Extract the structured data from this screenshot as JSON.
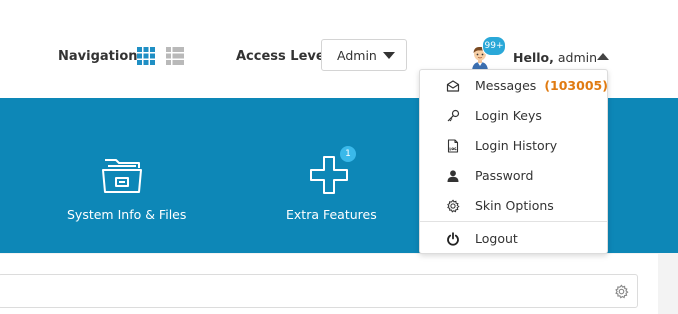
{
  "header": {
    "navigation_label": "Navigation",
    "access_level_label": "Access Level",
    "access_level_value": "Admin",
    "avatar_badge": "99+",
    "greeting": "Hello,",
    "username": "admin"
  },
  "tiles": [
    {
      "label": "System Info & Files",
      "icon": "folder-icon"
    },
    {
      "label": "Extra Features",
      "icon": "plus-icon",
      "badge": "1"
    }
  ],
  "user_menu": {
    "items": [
      {
        "label": "Messages",
        "count": "(103005)",
        "icon": "envelope-icon"
      },
      {
        "label": "Login Keys",
        "icon": "key-icon"
      },
      {
        "label": "Login History",
        "icon": "log-file-icon"
      },
      {
        "label": "Password",
        "icon": "user-icon"
      },
      {
        "label": "Skin Options",
        "icon": "gear-icon"
      },
      {
        "label": "Logout",
        "icon": "power-icon"
      }
    ]
  },
  "colors": {
    "banner": "#0d87b7",
    "badge": "#2aa8d8",
    "count": "#e07b12"
  }
}
